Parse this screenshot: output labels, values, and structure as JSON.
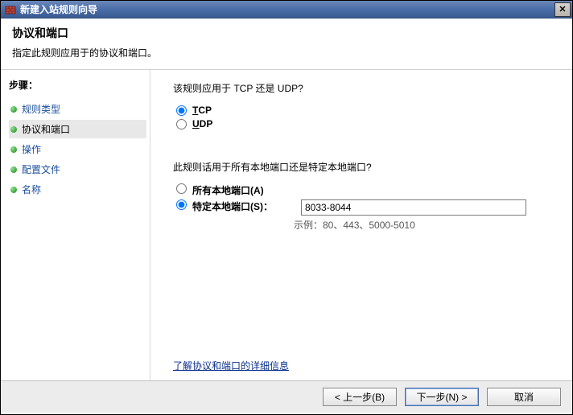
{
  "window": {
    "title": "新建入站规则向导"
  },
  "header": {
    "heading": "协议和端口",
    "subtitle": "指定此规则应用于的协议和端口。"
  },
  "sidebar": {
    "steps_label": "步骤：",
    "items": [
      {
        "label": "规则类型",
        "active": false
      },
      {
        "label": "协议和端口",
        "active": true
      },
      {
        "label": "操作",
        "active": false
      },
      {
        "label": "配置文件",
        "active": false
      },
      {
        "label": "名称",
        "active": false
      }
    ]
  },
  "content": {
    "protocol_question": "该规则应用于 TCP 还是 UDP?",
    "tcp_label_html": "TCP",
    "tcp_underline": "T",
    "udp_label_html": "UDP",
    "udp_underline": "U",
    "protocol_selected": "tcp",
    "port_question": "此规则话用于所有本地端口还是特定本地端口?",
    "all_ports_label": "所有本地端口",
    "all_ports_accel": "(A)",
    "specific_ports_label": "特定本地端口",
    "specific_ports_accel": "(S)",
    "specific_ports_colon": "：",
    "port_selected": "specific",
    "port_value": "8033-8044",
    "port_example": "示例：80、443、5000-5010",
    "learn_more": "了解协议和端口的详细信息"
  },
  "footer": {
    "back": "< 上一步(B)",
    "next": "下一步(N) >",
    "cancel": "取消"
  }
}
